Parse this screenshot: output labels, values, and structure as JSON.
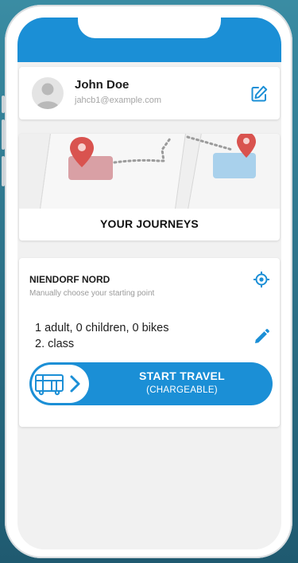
{
  "profile": {
    "name": "John Doe",
    "email": "jahcb1@example.com"
  },
  "journeys": {
    "title": "YOUR JOURNEYS"
  },
  "trip": {
    "station": "NIENDORF NORD",
    "hint": "Manually choose your starting point",
    "passengers_line1": "1 adult, 0 children, 0 bikes",
    "passengers_line2": "2. class"
  },
  "start_button": {
    "label": "START TRAVEL",
    "sublabel": "(CHARGEABLE)"
  },
  "colors": {
    "accent": "#1b8fd6",
    "pin": "#d9534f"
  },
  "icons": [
    "avatar-icon",
    "edit-icon",
    "map-pin-icon",
    "locate-icon",
    "pencil-icon",
    "bus-icon",
    "chevron-right-icon"
  ]
}
